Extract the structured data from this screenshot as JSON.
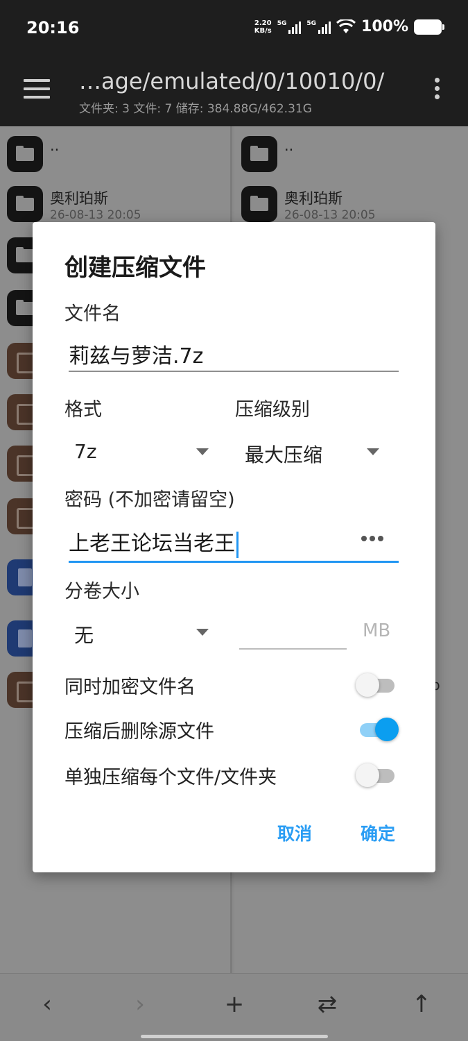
{
  "status_bar": {
    "time": "20:16",
    "net_speed_value": "2.20",
    "net_speed_unit": "KB/s",
    "sim1_label": "5G",
    "sim2_label": "5G",
    "battery_text": "100%"
  },
  "app_bar": {
    "path": "…age/emulated/0/10010/0/",
    "info": "文件夹: 3  文件: 7  储存: 384.88G/462.31G",
    "icons": {
      "menu": "hamburger-menu-icon",
      "more": "more-vertical-icon"
    }
  },
  "left_pane": {
    "rows": [
      {
        "icon": "folder",
        "name": "..",
        "date": ""
      },
      {
        "icon": "folder",
        "name": "奥利珀斯",
        "date": "26-08-13 20:05"
      }
    ]
  },
  "right_pane": {
    "rows": [
      {
        "icon": "folder",
        "name": "..",
        "date": ""
      },
      {
        "icon": "folder",
        "name": "奥利珀斯",
        "date": "26-08-13 20:05"
      }
    ],
    "stray_text": "p"
  },
  "dialog": {
    "title": "创建压缩文件",
    "filename_label": "文件名",
    "filename_value": "莉兹与萝洁.7z",
    "format_label": "格式",
    "format_value": "7z",
    "level_label": "压缩级别",
    "level_value": "最大压缩",
    "password_label": "密码 (不加密请留空)",
    "password_value": "上老王论坛当老王",
    "volume_label": "分卷大小",
    "volume_value": "无",
    "volume_unit": "MB",
    "switches": [
      {
        "label": "同时加密文件名",
        "on": false
      },
      {
        "label": "压缩后删除源文件",
        "on": true
      },
      {
        "label": "单独压缩每个文件/文件夹",
        "on": false
      }
    ],
    "cancel_label": "取消",
    "ok_label": "确定",
    "accent_color": "#2196f3"
  },
  "bottom_nav": {
    "back": "‹",
    "forward": "›",
    "add": "+",
    "swap": "⇄",
    "up": "↑"
  }
}
